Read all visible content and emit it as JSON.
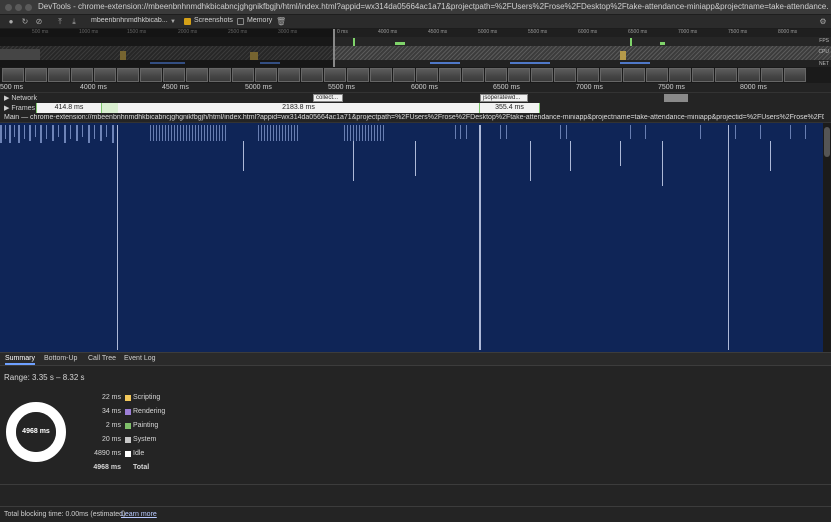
{
  "window": {
    "title": "DevTools - chrome-extension://mbeenbnhnmdhkbicabncjghgnikfbgjh/html/index.html?appid=wx314da05664ac1a71&projectpath=%2FUsers%2Frose%2FDesktop%2Ftake-attendance-miniapp&projectname=take-attendance..."
  },
  "toolbar": {
    "profile_select": "mbeenbnhnmdhkbicab...",
    "screenshots_label": "Screenshots",
    "screenshots_checked": true,
    "memory_label": "Memory",
    "memory_checked": false
  },
  "overview": {
    "ticks": [
      "500 ms",
      "1000 ms",
      "1500 ms",
      "2000 ms",
      "2500 ms",
      "3000 ms",
      "0 ms",
      "4000 ms",
      "4500 ms",
      "5000 ms",
      "5500 ms",
      "6000 ms",
      "6500 ms",
      "7000 ms",
      "7500 ms",
      "8000 ms"
    ],
    "fps_label": "FPS",
    "cpu_label": "CPU",
    "net_label": "NET"
  },
  "ruler": {
    "ticks": [
      "500 ms",
      "4000 ms",
      "4500 ms",
      "5000 ms",
      "5500 ms",
      "6000 ms",
      "6500 ms",
      "7000 ms",
      "7500 ms",
      "8000 ms"
    ]
  },
  "tracks": {
    "network_label": "Network",
    "network_items": [
      "collect...",
      "jsoperatewd..."
    ],
    "frames_label": "Frames",
    "frames": [
      "414.8 ms",
      "2183.8 ms",
      "355.4 ms"
    ],
    "main_label": "Main — chrome-extension://mbeenbnhnmdhkbicabncjghgnikfbgjh/html/index.html?appid=wx314da05664ac1a71&projectpath=%2FUsers%2Frose%2FDesktop%2Ftake-attendance-miniapp&projectname=take-attendance-miniapp&projectid=%2FUsers%2Frose%2FDesktop%2F..."
  },
  "tabs": [
    "Summary",
    "Bottom-Up",
    "Call Tree",
    "Event Log"
  ],
  "summary": {
    "range": "Range: 3.35 s – 8.32 s",
    "total_center": "4968 ms",
    "rows": [
      {
        "value": "22 ms",
        "name": "Scripting",
        "color": "#f2c85b"
      },
      {
        "value": "34 ms",
        "name": "Rendering",
        "color": "#9d7fd6"
      },
      {
        "value": "2 ms",
        "name": "Painting",
        "color": "#7fbf6a"
      },
      {
        "value": "20 ms",
        "name": "System",
        "color": "#c8c8c8"
      },
      {
        "value": "4890 ms",
        "name": "Idle",
        "color": "#ffffff"
      },
      {
        "value": "4968 ms",
        "name": "Total",
        "color": ""
      }
    ]
  },
  "status": {
    "blocking_text": "Total blocking time: 0.00ms (estimated)",
    "learn_more": "Learn more"
  }
}
